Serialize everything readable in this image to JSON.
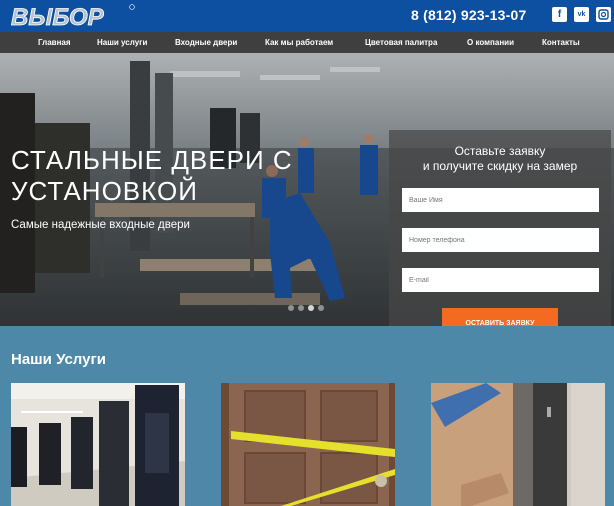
{
  "header": {
    "logo_text": "ВЫБОР",
    "phone": "8 (812) 923-13-07",
    "social": [
      {
        "name": "facebook",
        "glyph": "f"
      },
      {
        "name": "vkontakte",
        "glyph": "vk"
      },
      {
        "name": "instagram",
        "glyph": "ig"
      }
    ]
  },
  "nav": {
    "items": [
      "Главная",
      "Наши услуги",
      "Входные двери",
      "Как мы работаем",
      "Цветовая палитра",
      "О компании",
      "Контакты"
    ]
  },
  "hero": {
    "title": "СТАЛЬНЫЕ ДВЕРИ С УСТАНОВКОЙ",
    "subtitle": "Самые надежные входные двери"
  },
  "form": {
    "title_line1": "Оставьте заявку",
    "title_line2": "и получите скидку на замер",
    "name_placeholder": "Ваше Имя",
    "phone_placeholder": "Номер телефона",
    "email_placeholder": "E-mail",
    "submit_label": "ОСТАВИТЬ ЗАЯВКУ"
  },
  "services": {
    "title": "Наши Услуги"
  },
  "colors": {
    "brand_blue": "#0d4fa0",
    "nav_bg": "#3f3f3f",
    "accent_orange": "#f26b21",
    "section_bg": "#4e88a9"
  }
}
